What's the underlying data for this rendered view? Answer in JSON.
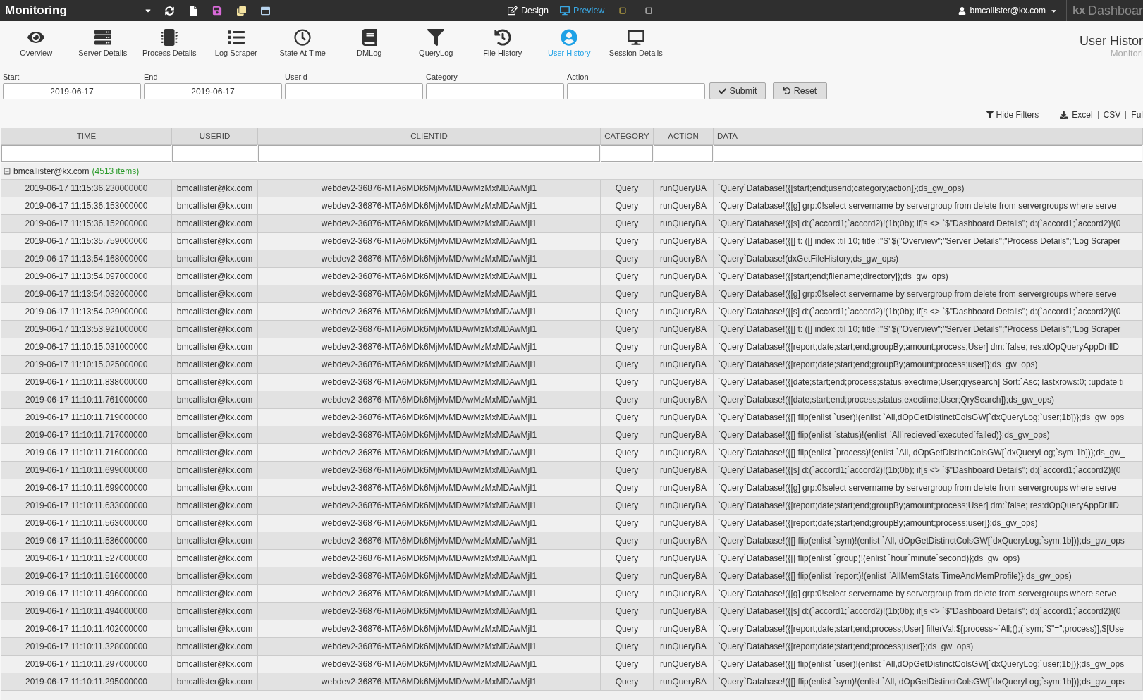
{
  "top_bar": {
    "title": "Monitoring",
    "modes": [
      {
        "label": "Design",
        "selected": false
      },
      {
        "label": "Preview",
        "selected": true
      }
    ],
    "user": "bmcallister@kx.com",
    "logo": {
      "mark": "kx",
      "text": "Dashboar"
    }
  },
  "nav": {
    "items": [
      {
        "label": "Overview",
        "selected": false
      },
      {
        "label": "Server Details",
        "selected": false
      },
      {
        "label": "Process Details",
        "selected": false
      },
      {
        "label": "Log Scraper",
        "selected": false
      },
      {
        "label": "State At Time",
        "selected": false
      },
      {
        "label": "DMLog",
        "selected": false
      },
      {
        "label": "QueryLog",
        "selected": false
      },
      {
        "label": "File History",
        "selected": false
      },
      {
        "label": "User History",
        "selected": true
      },
      {
        "label": "Session Details",
        "selected": false
      }
    ],
    "page_title": "User Histor",
    "page_subtitle": "Monitori"
  },
  "filters": {
    "fields": [
      {
        "label": "Start",
        "value": "2019-06-17"
      },
      {
        "label": "End",
        "value": "2019-06-17"
      },
      {
        "label": "Userid"
      },
      {
        "label": "Category"
      },
      {
        "label": "Action"
      }
    ],
    "buttons": [
      {
        "label": "Submit",
        "kind": "submit"
      },
      {
        "label": "Reset",
        "kind": "reset"
      }
    ]
  },
  "actions": {
    "hide_filters": "Hide Filters",
    "exports": [
      "Excel",
      "CSV",
      "Ful"
    ]
  },
  "table": {
    "columns": [
      "TIME",
      "USERID",
      "CLIENTID",
      "CATEGORY",
      "ACTION",
      "DATA"
    ],
    "group": {
      "name": "bmcallister@kx.com",
      "count": "(4513 items)",
      "expanded": true
    },
    "rows": [
      {
        "time": "2019-06-17 11:15:36.230000000",
        "userid": "bmcallister@kx.com",
        "clientid": "webdev2-36876-MTA6MDk6MjMvMDAwMzMxMDAwMjI1",
        "category": "Query",
        "action": "runQueryBA",
        "data": "`Query`Database!({[start;end;userid;category;action]};ds_gw_ops)"
      },
      {
        "time": "2019-06-17 11:15:36.153000000",
        "userid": "bmcallister@kx.com",
        "clientid": "webdev2-36876-MTA6MDk6MjMvMDAwMzMxMDAwMjI1",
        "category": "Query",
        "action": "runQueryBA",
        "data": "`Query`Database!({[g] grp:0!select servername by servergroup from delete from servergroups where serve"
      },
      {
        "time": "2019-06-17 11:15:36.152000000",
        "userid": "bmcallister@kx.com",
        "clientid": "webdev2-36876-MTA6MDk6MjMvMDAwMzMxMDAwMjI1",
        "category": "Query",
        "action": "runQueryBA",
        "data": "`Query`Database!({[s] d:(`accord1;`accord2)!(1b;0b); if[s <> `$\"Dashboard Details\"; d:(`accord1;`accord2)!(0"
      },
      {
        "time": "2019-06-17 11:15:35.759000000",
        "userid": "bmcallister@kx.com",
        "clientid": "webdev2-36876-MTA6MDk6MjMvMDAwMzMxMDAwMjI1",
        "category": "Query",
        "action": "runQueryBA",
        "data": "`Query`Database!({[] t: ([] index :til 10; title :\"S\"$(\"Overview\";\"Server Details\";\"Process Details\";\"Log Scraper"
      },
      {
        "time": "2019-06-17 11:13:54.168000000",
        "userid": "bmcallister@kx.com",
        "clientid": "webdev2-36876-MTA6MDk6MjMvMDAwMzMxMDAwMjI1",
        "category": "Query",
        "action": "runQueryBA",
        "data": "`Query`Database!(dxGetFileHistory;ds_gw_ops)"
      },
      {
        "time": "2019-06-17 11:13:54.097000000",
        "userid": "bmcallister@kx.com",
        "clientid": "webdev2-36876-MTA6MDk6MjMvMDAwMzMxMDAwMjI1",
        "category": "Query",
        "action": "runQueryBA",
        "data": "`Query`Database!({[start;end;filename;directory]};ds_gw_ops)"
      },
      {
        "time": "2019-06-17 11:13:54.032000000",
        "userid": "bmcallister@kx.com",
        "clientid": "webdev2-36876-MTA6MDk6MjMvMDAwMzMxMDAwMjI1",
        "category": "Query",
        "action": "runQueryBA",
        "data": "`Query`Database!({[g] grp:0!select servername by servergroup from delete from servergroups where serve"
      },
      {
        "time": "2019-06-17 11:13:54.029000000",
        "userid": "bmcallister@kx.com",
        "clientid": "webdev2-36876-MTA6MDk6MjMvMDAwMzMxMDAwMjI1",
        "category": "Query",
        "action": "runQueryBA",
        "data": "`Query`Database!({[s] d:(`accord1;`accord2)!(1b;0b); if[s <> `$\"Dashboard Details\"; d:(`accord1;`accord2)!(0"
      },
      {
        "time": "2019-06-17 11:13:53.921000000",
        "userid": "bmcallister@kx.com",
        "clientid": "webdev2-36876-MTA6MDk6MjMvMDAwMzMxMDAwMjI1",
        "category": "Query",
        "action": "runQueryBA",
        "data": "`Query`Database!({[] t: ([] index :til 10; title :\"S\"$(\"Overview\";\"Server Details\";\"Process Details\";\"Log Scraper"
      },
      {
        "time": "2019-06-17 11:10:15.031000000",
        "userid": "bmcallister@kx.com",
        "clientid": "webdev2-36876-MTA6MDk6MjMvMDAwMzMxMDAwMjI1",
        "category": "Query",
        "action": "runQueryBA",
        "data": "`Query`Database!({[report;date;start;end;groupBy;amount;process;User] dm:`false; res:dOpQueryAppDrillD"
      },
      {
        "time": "2019-06-17 11:10:15.025000000",
        "userid": "bmcallister@kx.com",
        "clientid": "webdev2-36876-MTA6MDk6MjMvMDAwMzMxMDAwMjI1",
        "category": "Query",
        "action": "runQueryBA",
        "data": "`Query`Database!({[report;date;start;end;groupBy;amount;process;user]};ds_gw_ops)"
      },
      {
        "time": "2019-06-17 11:10:11.838000000",
        "userid": "bmcallister@kx.com",
        "clientid": "webdev2-36876-MTA6MDk6MjMvMDAwMzMxMDAwMjI1",
        "category": "Query",
        "action": "runQueryBA",
        "data": "`Query`Database!({[date;start;end;process;status;exectime;User;qrysearch] Sort:`Asc; lastxrows:0; :update ti"
      },
      {
        "time": "2019-06-17 11:10:11.761000000",
        "userid": "bmcallister@kx.com",
        "clientid": "webdev2-36876-MTA6MDk6MjMvMDAwMzMxMDAwMjI1",
        "category": "Query",
        "action": "runQueryBA",
        "data": "`Query`Database!({[date;start;end;process;status;exectime;User;QrySearch]};ds_gw_ops)"
      },
      {
        "time": "2019-06-17 11:10:11.719000000",
        "userid": "bmcallister@kx.com",
        "clientid": "webdev2-36876-MTA6MDk6MjMvMDAwMzMxMDAwMjI1",
        "category": "Query",
        "action": "runQueryBA",
        "data": "`Query`Database!({[] flip(enlist `user)!(enlist `All,dOpGetDistinctColsGW[`dxQueryLog;`user;1b])};ds_gw_ops"
      },
      {
        "time": "2019-06-17 11:10:11.717000000",
        "userid": "bmcallister@kx.com",
        "clientid": "webdev2-36876-MTA6MDk6MjMvMDAwMzMxMDAwMjI1",
        "category": "Query",
        "action": "runQueryBA",
        "data": "`Query`Database!({[] flip(enlist `status)!(enlist `All`recieved`executed`failed)};ds_gw_ops)"
      },
      {
        "time": "2019-06-17 11:10:11.716000000",
        "userid": "bmcallister@kx.com",
        "clientid": "webdev2-36876-MTA6MDk6MjMvMDAwMzMxMDAwMjI1",
        "category": "Query",
        "action": "runQueryBA",
        "data": "`Query`Database!({[] flip(enlist `process)!(enlist `All, dOpGetDistinctColsGW[`dxQueryLog;`sym;1b])};ds_gw_"
      },
      {
        "time": "2019-06-17 11:10:11.699000000",
        "userid": "bmcallister@kx.com",
        "clientid": "webdev2-36876-MTA6MDk6MjMvMDAwMzMxMDAwMjI1",
        "category": "Query",
        "action": "runQueryBA",
        "data": "`Query`Database!({[s] d:(`accord1;`accord2)!(1b;0b); if[s <> `$\"Dashboard Details\"; d:(`accord1;`accord2)!(0"
      },
      {
        "time": "2019-06-17 11:10:11.699000000",
        "userid": "bmcallister@kx.com",
        "clientid": "webdev2-36876-MTA6MDk6MjMvMDAwMzMxMDAwMjI1",
        "category": "Query",
        "action": "runQueryBA",
        "data": "`Query`Database!({[g] grp:0!select servername by servergroup from delete from servergroups where serve"
      },
      {
        "time": "2019-06-17 11:10:11.633000000",
        "userid": "bmcallister@kx.com",
        "clientid": "webdev2-36876-MTA6MDk6MjMvMDAwMzMxMDAwMjI1",
        "category": "Query",
        "action": "runQueryBA",
        "data": "`Query`Database!({[report;date;start;end;groupBy;amount;process;User] dm:`false; res:dOpQueryAppDrillD"
      },
      {
        "time": "2019-06-17 11:10:11.563000000",
        "userid": "bmcallister@kx.com",
        "clientid": "webdev2-36876-MTA6MDk6MjMvMDAwMzMxMDAwMjI1",
        "category": "Query",
        "action": "runQueryBA",
        "data": "`Query`Database!({[report;date;start;end;groupBy;amount;process;user]};ds_gw_ops)"
      },
      {
        "time": "2019-06-17 11:10:11.536000000",
        "userid": "bmcallister@kx.com",
        "clientid": "webdev2-36876-MTA6MDk6MjMvMDAwMzMxMDAwMjI1",
        "category": "Query",
        "action": "runQueryBA",
        "data": "`Query`Database!({[] flip(enlist `sym)!(enlist `All, dOpGetDistinctColsGW[`dxQueryLog;`sym;1b])};ds_gw_ops"
      },
      {
        "time": "2019-06-17 11:10:11.527000000",
        "userid": "bmcallister@kx.com",
        "clientid": "webdev2-36876-MTA6MDk6MjMvMDAwMzMxMDAwMjI1",
        "category": "Query",
        "action": "runQueryBA",
        "data": "`Query`Database!({[] flip(enlist `group)!(enlist `hour`minute`second)};ds_gw_ops)"
      },
      {
        "time": "2019-06-17 11:10:11.516000000",
        "userid": "bmcallister@kx.com",
        "clientid": "webdev2-36876-MTA6MDk6MjMvMDAwMzMxMDAwMjI1",
        "category": "Query",
        "action": "runQueryBA",
        "data": "`Query`Database!({[] flip(enlist `report)!(enlist `AllMemStats`TimeAndMemProfile)};ds_gw_ops)"
      },
      {
        "time": "2019-06-17 11:10:11.496000000",
        "userid": "bmcallister@kx.com",
        "clientid": "webdev2-36876-MTA6MDk6MjMvMDAwMzMxMDAwMjI1",
        "category": "Query",
        "action": "runQueryBA",
        "data": "`Query`Database!({[g] grp:0!select servername by servergroup from delete from servergroups where serve"
      },
      {
        "time": "2019-06-17 11:10:11.494000000",
        "userid": "bmcallister@kx.com",
        "clientid": "webdev2-36876-MTA6MDk6MjMvMDAwMzMxMDAwMjI1",
        "category": "Query",
        "action": "runQueryBA",
        "data": "`Query`Database!({[s] d:(`accord1;`accord2)!(1b;0b); if[s <> `$\"Dashboard Details\"; d:(`accord1;`accord2)!(0"
      },
      {
        "time": "2019-06-17 11:10:11.402000000",
        "userid": "bmcallister@kx.com",
        "clientid": "webdev2-36876-MTA6MDk6MjMvMDAwMzMxMDAwMjI1",
        "category": "Query",
        "action": "runQueryBA",
        "data": "`Query`Database!({[report;date;start;end;process;User] filterVal:$[process~`All;();(`sym;`$\"=\";process)],$[Use"
      },
      {
        "time": "2019-06-17 11:10:11.328000000",
        "userid": "bmcallister@kx.com",
        "clientid": "webdev2-36876-MTA6MDk6MjMvMDAwMzMxMDAwMjI1",
        "category": "Query",
        "action": "runQueryBA",
        "data": "`Query`Database!({[report;date;start;end;process;user]};ds_gw_ops)"
      },
      {
        "time": "2019-06-17 11:10:11.297000000",
        "userid": "bmcallister@kx.com",
        "clientid": "webdev2-36876-MTA6MDk6MjMvMDAwMzMxMDAwMjI1",
        "category": "Query",
        "action": "runQueryBA",
        "data": "`Query`Database!({[] flip(enlist `user)!(enlist `All,dOpGetDistinctColsGW[`dxQueryLog;`user;1b])};ds_gw_ops"
      },
      {
        "time": "2019-06-17 11:10:11.295000000",
        "userid": "bmcallister@kx.com",
        "clientid": "webdev2-36876-MTA6MDk6MjMvMDAwMzMxMDAwMjI1",
        "category": "Query",
        "action": "runQueryBA",
        "data": "`Query`Database!({[] flip(enlist `sym)!(enlist `All, dOpGetDistinctColsGW[`dxQueryLog;`sym;1b])};ds_gw_ops"
      }
    ]
  }
}
